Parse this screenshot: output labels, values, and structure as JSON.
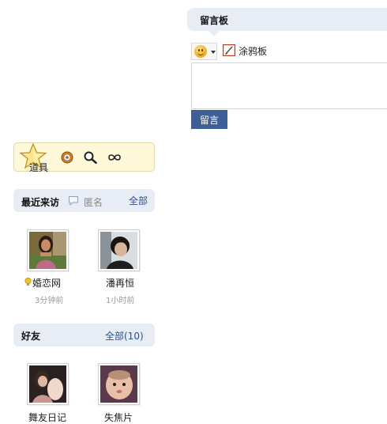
{
  "message_board": {
    "title": "留言板",
    "doodle_label": "涂鸦板",
    "submit_label": "留言",
    "textarea_value": ""
  },
  "tools": {
    "label": "道具",
    "icons": [
      "star-icon",
      "medal-icon",
      "magnifier-icon",
      "infinity-icon"
    ]
  },
  "recent_visitors": {
    "title": "最近来访",
    "anonymous_label": "匿名",
    "all_label": "全部",
    "visitors": [
      {
        "name": "婚恋网",
        "time": "3分钟前"
      },
      {
        "name": "潘再恒",
        "time": "1小时前"
      }
    ]
  },
  "friends": {
    "title": "好友",
    "all_label": "全部(10)",
    "items": [
      {
        "name": "舞友日记"
      },
      {
        "name": "失焦片"
      }
    ]
  },
  "colors": {
    "header_bg": "#e8edf5",
    "submit_bg": "#3e5f95",
    "link": "#2a4f8f",
    "tools_bg": "#fff8d9"
  }
}
